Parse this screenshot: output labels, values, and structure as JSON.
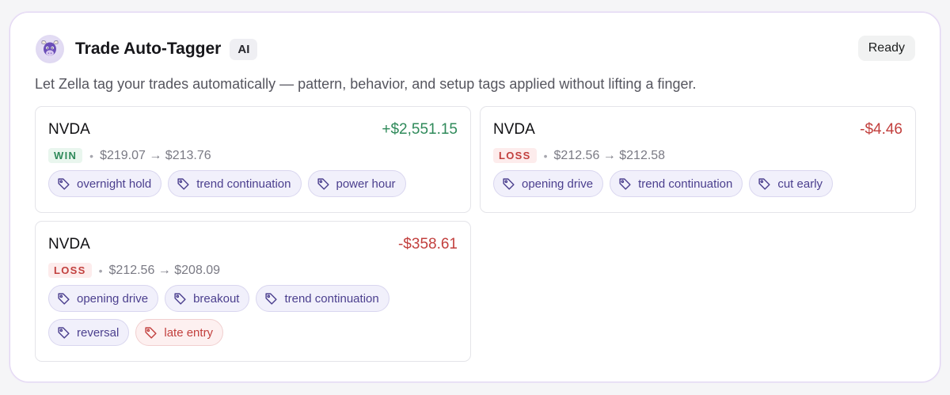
{
  "header": {
    "title": "Trade Auto-Tagger",
    "ai_badge": "AI",
    "status": "Ready",
    "logo_icon": "bull-mascot-icon"
  },
  "description": "Let Zella tag your trades automatically — pattern, behavior, and setup tags applied without lifting a finger.",
  "colors": {
    "win": "#2f8a5a",
    "loss": "#c2403e",
    "tag_text": "#4b3f8e",
    "tag_bg": "#f1f0fb",
    "panel_border": "#e2d6f3"
  },
  "trades": [
    {
      "symbol": "NVDA",
      "pnl": "+$2,551.15",
      "result": "WIN",
      "prices": "$219.07 → $213.76",
      "tags": [
        {
          "label": "overnight hold",
          "variant": "default"
        },
        {
          "label": "trend continuation",
          "variant": "default"
        },
        {
          "label": "power hour",
          "variant": "default"
        }
      ]
    },
    {
      "symbol": "NVDA",
      "pnl": "-$4.46",
      "result": "LOSS",
      "prices": "$212.56 → $212.58",
      "tags": [
        {
          "label": "opening drive",
          "variant": "default"
        },
        {
          "label": "trend continuation",
          "variant": "default"
        },
        {
          "label": "cut early",
          "variant": "default"
        }
      ]
    },
    {
      "symbol": "NVDA",
      "pnl": "-$358.61",
      "result": "LOSS",
      "prices": "$212.56 → $208.09",
      "tags": [
        {
          "label": "opening drive",
          "variant": "default"
        },
        {
          "label": "breakout",
          "variant": "default"
        },
        {
          "label": "trend continuation",
          "variant": "default"
        },
        {
          "label": "reversal",
          "variant": "default"
        },
        {
          "label": "late entry",
          "variant": "warning"
        }
      ]
    }
  ]
}
